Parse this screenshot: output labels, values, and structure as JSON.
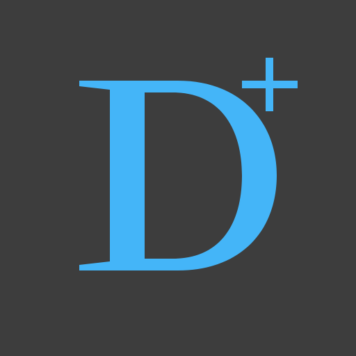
{
  "app_icon": {
    "logo_text": "D+",
    "background_color": "#3d3d3d",
    "accent_color": "#44b5f8"
  }
}
